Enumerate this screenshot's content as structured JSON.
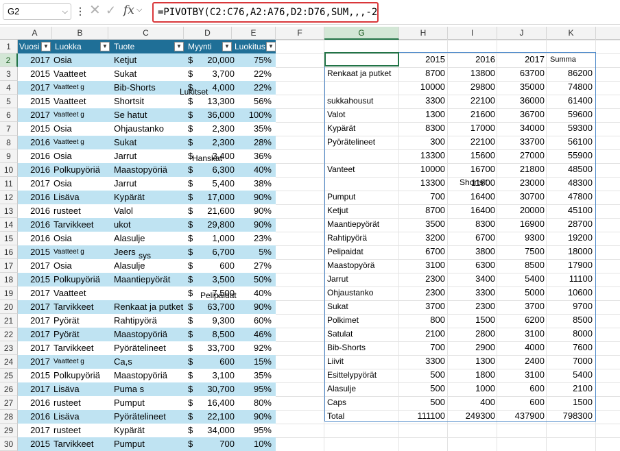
{
  "formula_bar": {
    "name_box": "G2",
    "formula": "=PIVOTBY(C2:C76,A2:A76,D2:D76,SUM,,,-2)",
    "x_icon": "close-icon",
    "check_icon": "check-icon",
    "fx_label": "fx"
  },
  "columns": [
    "A",
    "B",
    "C",
    "D",
    "E",
    "F",
    "G",
    "H",
    "I",
    "J",
    "K"
  ],
  "rows": [
    "1",
    "2",
    "3",
    "4",
    "5",
    "6",
    "7",
    "8",
    "9",
    "10",
    "11",
    "12",
    "13",
    "14",
    "15",
    "16",
    "17",
    "18",
    "19",
    "20",
    "21",
    "22",
    "23",
    "24",
    "25",
    "26",
    "27",
    "28",
    "29",
    "30"
  ],
  "table": {
    "headers": [
      "Vuosi",
      "Luokka",
      "Tuote",
      "Myynti",
      "Luokitus"
    ],
    "rows": [
      [
        "2017",
        "Osia",
        "Ketjut",
        "$",
        "20,000",
        "75%"
      ],
      [
        "2015",
        "Vaatteet",
        "Sukat",
        "$",
        "3,700",
        "22%"
      ],
      [
        "2017",
        "Vaatteet g",
        "Bib-Shorts",
        "$",
        "4,000",
        "22%"
      ],
      [
        "2015",
        "Vaatteet",
        "Shortsit",
        "$",
        "13,300",
        "56%"
      ],
      [
        "2017",
        "Vaatteet g",
        "Se hatut",
        "$",
        "36,000",
        "100%"
      ],
      [
        "2015",
        "Osia",
        "Ohjaustanko",
        "$",
        "2,300",
        "35%"
      ],
      [
        "2016",
        "Vaatteet g",
        "Sukat",
        "$",
        "2,300",
        "28%"
      ],
      [
        "2016",
        "Osia",
        "Jarrut",
        "$",
        "3,400",
        "36%"
      ],
      [
        "2016",
        "Polkupyöriä",
        "Maastopyöriä",
        "$",
        "6,300",
        "40%"
      ],
      [
        "2017",
        "Osia",
        "Jarrut",
        "$",
        "5,400",
        "38%"
      ],
      [
        "2016",
        "Lisäva",
        "Kypärät",
        "$",
        "17,000",
        "90%"
      ],
      [
        "2016",
        "rusteet",
        "Valol",
        "$",
        "21,600",
        "90%"
      ],
      [
        "2016",
        "Tarvikkeet",
        "ukot",
        "$",
        "29,800",
        "90%"
      ],
      [
        "2016",
        "Osia",
        "Alasulje",
        "$",
        "1,000",
        "23%"
      ],
      [
        "2015",
        "Vaatteet g",
        "Jeers",
        "$",
        "6,700",
        "5%"
      ],
      [
        "2017",
        "Osia",
        "Alasulje",
        "$",
        "600",
        "27%"
      ],
      [
        "2015",
        "Polkupyöriä",
        "Maantiepyörät",
        "$",
        "3,500",
        "50%"
      ],
      [
        "2017",
        "Vaatteet",
        "",
        "$",
        "7,500",
        "40%"
      ],
      [
        "2017",
        "Tarvikkeet",
        "Renkaat ja putket",
        "$",
        "63,700",
        "90%"
      ],
      [
        "2017",
        "Pyörät",
        "Rahtipyörä",
        "$",
        "9,300",
        "60%"
      ],
      [
        "2017",
        "Pyörät",
        "Maastopyöriä",
        "$",
        "8,500",
        "46%"
      ],
      [
        "2017",
        "Tarvikkeet",
        "Pyörätelineet",
        "$",
        "33,700",
        "92%"
      ],
      [
        "2017",
        "Vaatteet g",
        "Ca,s",
        "$",
        "600",
        "15%"
      ],
      [
        "2015",
        "Polkupyöriä",
        "Maastopyöriä",
        "$",
        "3,100",
        "35%"
      ],
      [
        "2017",
        "Lisäva",
        "Puma s",
        "$",
        "30,700",
        "95%"
      ],
      [
        "2016",
        "rusteet",
        "Pumput",
        "$",
        "16,400",
        "80%"
      ],
      [
        "2016",
        "Lisäva",
        "Pyörätelineet",
        "$",
        "22,100",
        "90%"
      ],
      [
        "2017",
        "rusteet",
        "Kypärät",
        "$",
        "34,000",
        "95%"
      ],
      [
        "2015",
        "Tarvikkeet",
        "Pumput",
        "$",
        "700",
        "10%"
      ]
    ],
    "overlays": [
      "Lukitset",
      "Hanskat",
      "Pelipaidat",
      "sys"
    ]
  },
  "pivot": {
    "header": [
      "",
      "2015",
      "2016",
      "2017",
      "Summa"
    ],
    "rows": [
      [
        "Renkaat ja putket",
        "8700",
        "13800",
        "63700",
        "86200"
      ],
      [
        "",
        "10000",
        "29800",
        "35000",
        "74800"
      ],
      [
        "sukkahousut",
        "3300",
        "22100",
        "36000",
        "61400"
      ],
      [
        "Valot",
        "1300",
        "21600",
        "36700",
        "59600"
      ],
      [
        "Kypärät",
        "8300",
        "17000",
        "34000",
        "59300"
      ],
      [
        "Pyörätelineet",
        "300",
        "22100",
        "33700",
        "56100"
      ],
      [
        "",
        "13300",
        "15600",
        "27000",
        "55900"
      ],
      [
        "Vanteet",
        "10000",
        "16700",
        "21800",
        "48500"
      ],
      [
        "",
        "13300",
        "11800",
        "23000",
        "48300"
      ],
      [
        "Pumput",
        "700",
        "16400",
        "30700",
        "47800"
      ],
      [
        "Ketjut",
        "8700",
        "16400",
        "20000",
        "45100"
      ],
      [
        "Maantiepyörät",
        "3500",
        "8300",
        "16900",
        "28700"
      ],
      [
        "Rahtipyörä",
        "3200",
        "6700",
        "9300",
        "19200"
      ],
      [
        "Pelipaidat",
        "6700",
        "3800",
        "7500",
        "18000"
      ],
      [
        "Maastopyörä",
        "3100",
        "6300",
        "8500",
        "17900"
      ],
      [
        "Jarrut",
        "2300",
        "3400",
        "5400",
        "11100"
      ],
      [
        "Ohjaustanko",
        "2300",
        "3300",
        "5000",
        "10600"
      ],
      [
        "Sukat",
        "3700",
        "2300",
        "3700",
        "9700"
      ],
      [
        "Polkimet",
        "800",
        "1500",
        "6200",
        "8500"
      ],
      [
        "Satulat",
        "2100",
        "2800",
        "3100",
        "8000"
      ],
      [
        "Bib-Shorts",
        "700",
        "2900",
        "4000",
        "7600"
      ],
      [
        "Liivit",
        "3300",
        "1300",
        "2400",
        "7000"
      ],
      [
        "Esittelypyörät",
        "500",
        "1800",
        "3100",
        "5400"
      ],
      [
        "Alasulje",
        "500",
        "1000",
        "600",
        "2100"
      ],
      [
        "Caps",
        "500",
        "400",
        "600",
        "1500"
      ],
      [
        "Total",
        "111100",
        "249300",
        "437900",
        "798300"
      ]
    ],
    "overlay": "Shortsit"
  }
}
